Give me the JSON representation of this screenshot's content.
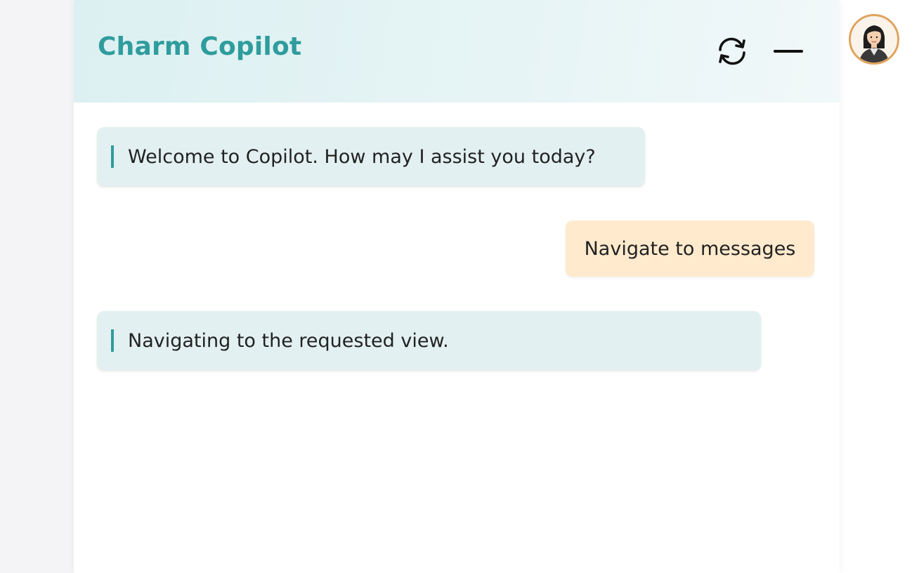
{
  "window": {
    "title": "Charm Copilot"
  },
  "header": {
    "refresh_icon": "refresh-icon",
    "minimize_icon": "minimize-icon"
  },
  "avatar": {
    "icon": "assistant-avatar-woman"
  },
  "messages": [
    {
      "role": "assistant",
      "text": "Welcome to Copilot. How may I assist you today?"
    },
    {
      "role": "user",
      "text": "Navigate to messages"
    },
    {
      "role": "assistant",
      "text": "Navigating to the requested view."
    }
  ],
  "colors": {
    "accent": "#2f9c9d",
    "assistant_bubble": "#e3f0f1",
    "user_bubble": "#ffeacd",
    "avatar_border": "#e0a35c"
  }
}
